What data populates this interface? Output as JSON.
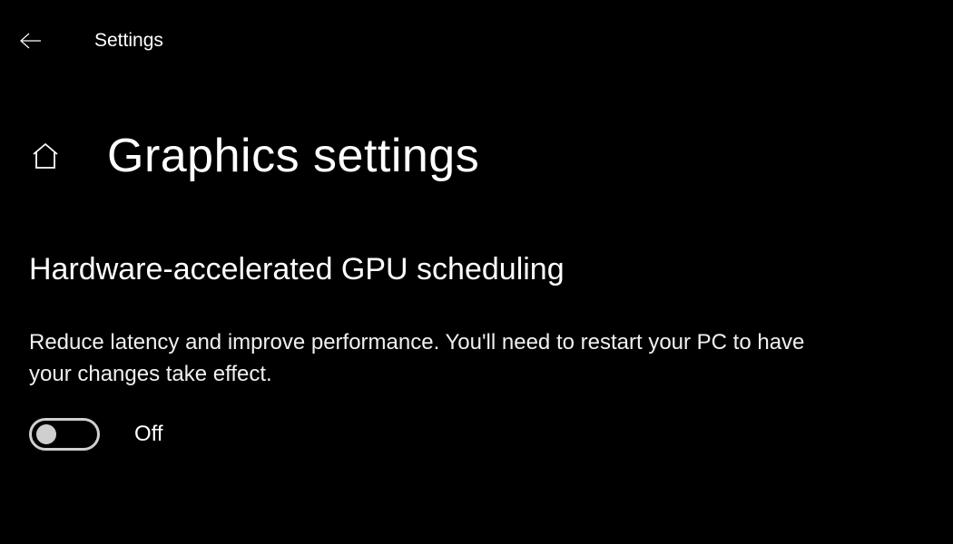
{
  "header": {
    "app_title": "Settings"
  },
  "page": {
    "title": "Graphics settings"
  },
  "section": {
    "heading": "Hardware-accelerated GPU scheduling",
    "description": "Reduce latency and improve performance. You'll need to restart your PC to have your changes take effect.",
    "toggle_state": "Off",
    "toggle_on": false
  }
}
